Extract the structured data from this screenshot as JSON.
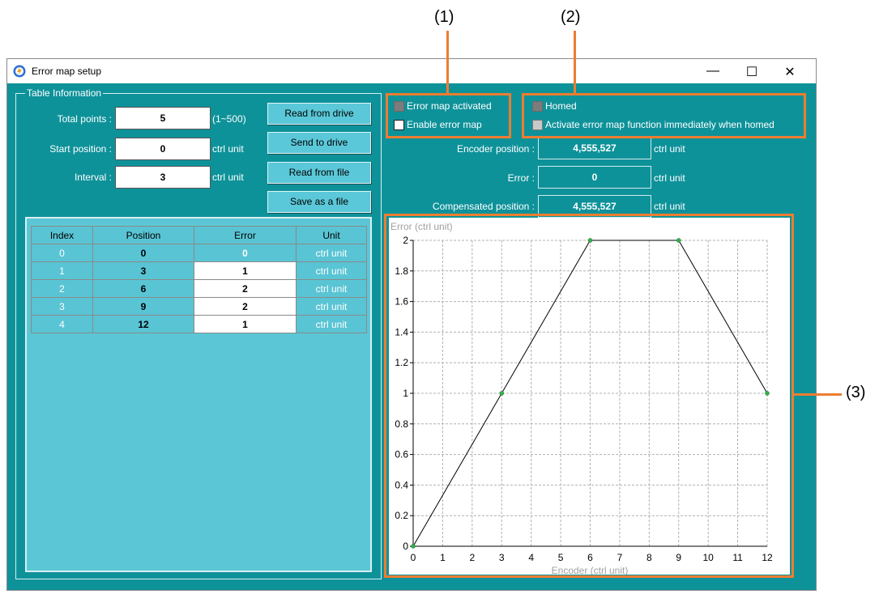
{
  "callouts": [
    "(1)",
    "(2)",
    "(3)"
  ],
  "window": {
    "title": "Error map setup",
    "min_glyph": "—",
    "max_glyph": "☐",
    "close_glyph": "✕"
  },
  "table_info": {
    "group_label": "Table Information",
    "total_points_label": "Total points :",
    "total_points_value": "5",
    "total_points_range": "(1~500)",
    "start_position_label": "Start position :",
    "start_position_value": "0",
    "start_position_unit": "ctrl unit",
    "interval_label": "Interval :",
    "interval_value": "3",
    "interval_unit": "ctrl unit"
  },
  "buttons": {
    "read_from_drive": "Read from drive",
    "send_to_drive": "Send to drive",
    "read_from_file": "Read from file",
    "save_as_file": "Save as a file"
  },
  "table": {
    "headers": [
      "Index",
      "Position",
      "Error",
      "Unit"
    ],
    "rows": [
      [
        "0",
        "0",
        "0",
        "ctrl unit"
      ],
      [
        "1",
        "3",
        "1",
        "ctrl unit"
      ],
      [
        "2",
        "6",
        "2",
        "ctrl unit"
      ],
      [
        "3",
        "9",
        "2",
        "ctrl unit"
      ],
      [
        "4",
        "12",
        "1",
        "ctrl unit"
      ]
    ]
  },
  "status": {
    "error_map_activated": "Error map activated",
    "enable_error_map": "Enable error map",
    "homed": "Homed",
    "activate_when_homed": "Activate error map function immediately when homed"
  },
  "readouts": {
    "encoder_label": "Encoder position :",
    "encoder_value": "4,555,527",
    "encoder_unit": "ctrl unit",
    "error_label": "Error :",
    "error_value": "0",
    "error_unit": "ctrl unit",
    "compensated_label": "Compensated position :",
    "compensated_value": "4,555,527",
    "compensated_unit": "ctrl unit"
  },
  "chart_data": {
    "type": "line",
    "ylabel": "Error (ctrl unit)",
    "xlabel": "Encoder (ctrl unit)",
    "x": [
      0,
      3,
      6,
      9,
      12
    ],
    "y": [
      0,
      1,
      2,
      2,
      1
    ],
    "xlim": [
      0,
      12
    ],
    "ylim": [
      0,
      2
    ],
    "xticks": [
      "0",
      "1",
      "2",
      "3",
      "4",
      "5",
      "6",
      "7",
      "8",
      "9",
      "10",
      "11",
      "12"
    ],
    "yticks": [
      "0",
      "0.2",
      "0.4",
      "0.6",
      "0.8",
      "1",
      "1.2",
      "1.4",
      "1.6",
      "1.8",
      "2"
    ],
    "grid": true,
    "line_color": "#000000",
    "marker_color": "#2fb34a"
  },
  "colors": {
    "window_bg": "#0e929a",
    "callout_outline": "#ed7d31",
    "table_panel": "#5bc7d6"
  }
}
